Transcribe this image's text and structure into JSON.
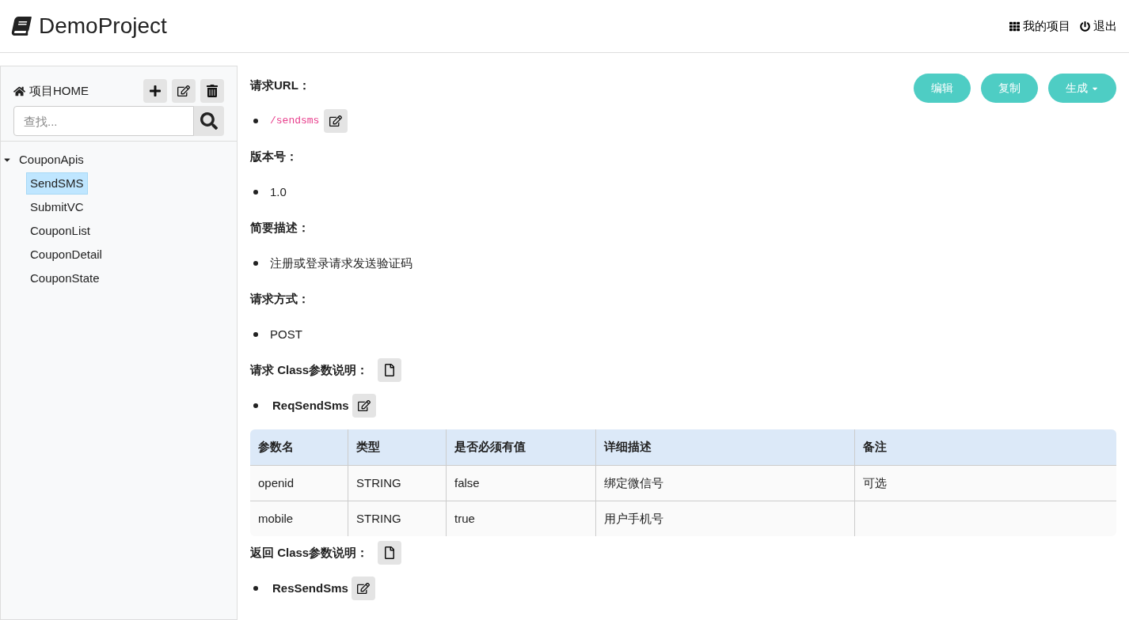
{
  "header": {
    "title": "DemoProject",
    "links": [
      {
        "kind": "projects",
        "label": "我的项目"
      },
      {
        "kind": "logout",
        "label": "退出"
      }
    ]
  },
  "sidebar": {
    "home": "项目HOME",
    "search": {
      "placeholder": "查找..."
    },
    "tree": [
      {
        "label": "CouponApis",
        "expanded": true,
        "selected": false,
        "children": [
          {
            "label": "SendSMS",
            "selected": true
          },
          {
            "label": "SubmitVC",
            "selected": false
          },
          {
            "label": "CouponList",
            "selected": false
          },
          {
            "label": "CouponDetail",
            "selected": false
          },
          {
            "label": "CouponState",
            "selected": false
          }
        ]
      }
    ]
  },
  "actions": [
    {
      "label": "编辑",
      "dropdown": false
    },
    {
      "label": "复制",
      "dropdown": false
    },
    {
      "label": "生成",
      "dropdown": true
    }
  ],
  "sections": [
    {
      "heading": "请求URL：",
      "kind": "code",
      "value": "/sendsms"
    },
    {
      "heading": "版本号：",
      "kind": "text",
      "value": "1.0"
    },
    {
      "heading": "简要描述：",
      "kind": "text",
      "value": "注册或登录请求发送验证码"
    },
    {
      "heading": "请求方式：",
      "kind": "text",
      "value": "POST"
    },
    {
      "heading": "请求 Class参数说明：",
      "kind": "class",
      "value": "ReqSendSms",
      "table": {
        "columns": [
          "参数名",
          "类型",
          "是否必须有值",
          "详细描述",
          "备注"
        ],
        "rows": [
          [
            "openid",
            "STRING",
            "false",
            "绑定微信号",
            "可选"
          ],
          [
            "mobile",
            "STRING",
            "true",
            "用户手机号",
            ""
          ]
        ]
      }
    },
    {
      "heading": "返回 Class参数说明：",
      "kind": "class",
      "value": "ResSendSms"
    }
  ]
}
